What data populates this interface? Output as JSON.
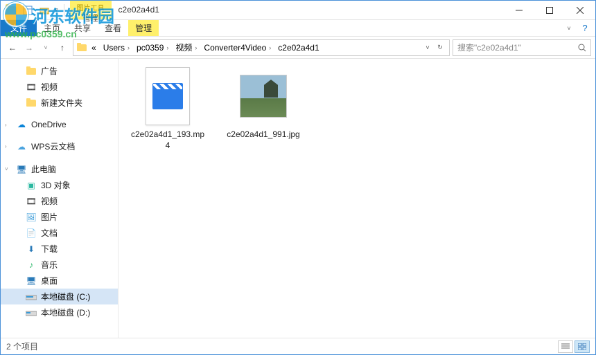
{
  "window": {
    "title": "c2e02a4d1",
    "tool_tab_top": "图片工具",
    "tool_tab_bottom": "管理"
  },
  "ribbon": {
    "file": "文件",
    "home": "主页",
    "share": "共享",
    "view": "查看",
    "manage": "管理"
  },
  "nav": {
    "back": "←",
    "forward": "→",
    "up": "↑"
  },
  "breadcrumb": {
    "prefix": "«",
    "items": [
      "Users",
      "pc0359",
      "视频",
      "Converter4Video",
      "c2e02a4d1"
    ]
  },
  "search": {
    "placeholder": "搜索\"c2e02a4d1\""
  },
  "sidebar": {
    "quick": [
      {
        "label": "广告",
        "icon": "folder"
      },
      {
        "label": "视频",
        "icon": "video"
      },
      {
        "label": "新建文件夹",
        "icon": "folder"
      }
    ],
    "onedrive": "OneDrive",
    "wps": "WPS云文档",
    "thispc": "此电脑",
    "pc_children": [
      {
        "label": "3D 对象",
        "icon": "3d"
      },
      {
        "label": "视频",
        "icon": "video"
      },
      {
        "label": "图片",
        "icon": "pictures"
      },
      {
        "label": "文档",
        "icon": "docs"
      },
      {
        "label": "下载",
        "icon": "downloads"
      },
      {
        "label": "音乐",
        "icon": "music"
      },
      {
        "label": "桌面",
        "icon": "desktop"
      },
      {
        "label": "本地磁盘 (C:)",
        "icon": "drive"
      },
      {
        "label": "本地磁盘 (D:)",
        "icon": "drive"
      }
    ],
    "selected_index": 7
  },
  "files": [
    {
      "name": "c2e02a4d1_193.mp4",
      "kind": "video"
    },
    {
      "name": "c2e02a4d1_991.jpg",
      "kind": "image"
    }
  ],
  "status": {
    "count_text": "2 个项目"
  },
  "watermark": {
    "text": "河东软件园",
    "url": "www.pc0359.cn"
  }
}
